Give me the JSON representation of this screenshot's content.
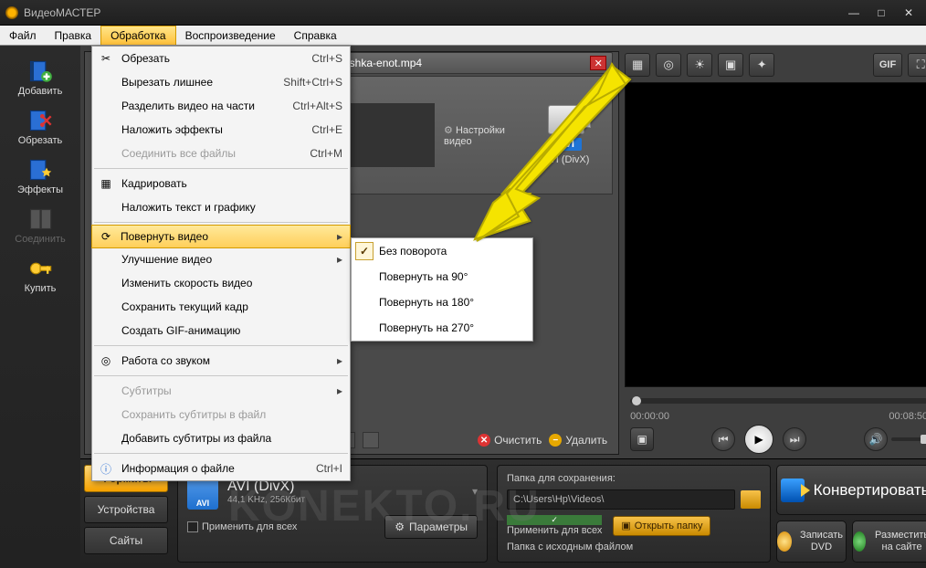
{
  "app": {
    "title": "ВидеоМАСТЕР"
  },
  "menubar": {
    "file": "Файл",
    "edit": "Правка",
    "process": "Обработка",
    "play": "Воспроизведение",
    "help": "Справка"
  },
  "sidebar": {
    "add": "Добавить",
    "crop": "Обрезать",
    "effects": "Эффекты",
    "join": "Соединить",
    "buy": "Купить"
  },
  "dd": {
    "crop": "Обрезать",
    "crop_s": "Ctrl+S",
    "trim": "Вырезать лишнее",
    "trim_s": "Shift+Ctrl+S",
    "split": "Разделить видео на части",
    "split_s": "Ctrl+Alt+S",
    "fx": "Наложить эффекты",
    "fx_s": "Ctrl+E",
    "joinall": "Соединить все файлы",
    "joinall_s": "Ctrl+M",
    "cropframe": "Кадрировать",
    "overlay": "Наложить текст и графику",
    "rotate": "Повернуть видео",
    "enhance": "Улучшение видео",
    "speed": "Изменить скорость видео",
    "saveframe": "Сохранить текущий кадр",
    "gif": "Создать GIF-анимацию",
    "audio": "Работа со звуком",
    "subs": "Субтитры",
    "savesubs": "Сохранить субтитры в файл",
    "addsubs": "Добавить субтитры из файла",
    "info": "Информация о файле",
    "info_s": "Ctrl+I"
  },
  "sub": {
    "none": "Без поворота",
    "r90": "Повернуть на 90°",
    "r180": "Повернуть на 180°",
    "r270": "Повернуть на 270°"
  },
  "file": {
    "name": "roshka-enot.mp4",
    "settings": "Настройки видео",
    "preset": "AVI (DivX)",
    "preset_badge": "AVI"
  },
  "filetools": {
    "clear": "Очистить",
    "remove": "Удалить"
  },
  "time": {
    "cur": "00:00:00",
    "dur": "00:08:50"
  },
  "tabs": {
    "formats": "Форматы",
    "devices": "Устройства",
    "sites": "Сайты"
  },
  "fmt": {
    "title": "AVI (DivX)",
    "sub": "44,1 KHz, 256Кбит",
    "file_badge": "AVI",
    "applyall": "Применить для всех",
    "params": "Параметры"
  },
  "save": {
    "label": "Папка для сохранения:",
    "path": "C:\\Users\\Hp\\Videos\\",
    "applyall": "Применить для всех",
    "srcfolder": "Папка с исходным файлом",
    "open": "Открыть папку"
  },
  "actions": {
    "convert": "Конвертировать",
    "dvd": "Записать DVD",
    "web": "Разместить на сайте"
  },
  "toolstrip": {
    "gif": "GIF"
  },
  "watermark": "KONEKTO.RU"
}
